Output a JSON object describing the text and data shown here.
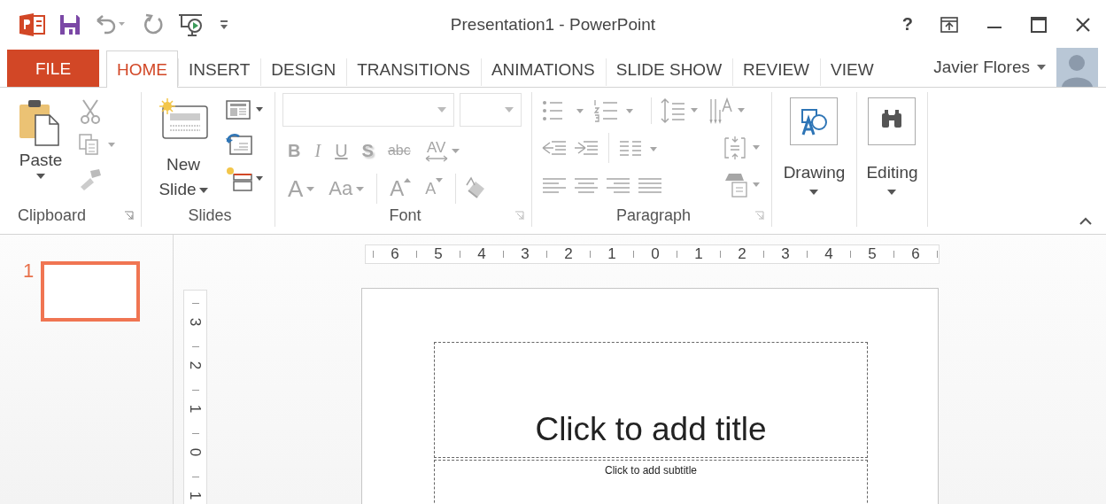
{
  "window": {
    "title": "Presentation1 - PowerPoint",
    "help": "?"
  },
  "tabs": [
    {
      "label": "FILE",
      "kind": "backstage",
      "selected": false
    },
    {
      "label": "HOME",
      "kind": "tab",
      "selected": true
    },
    {
      "label": "INSERT",
      "kind": "tab",
      "selected": false
    },
    {
      "label": "DESIGN",
      "kind": "tab",
      "selected": false
    },
    {
      "label": "TRANSITIONS",
      "kind": "tab",
      "selected": false
    },
    {
      "label": "ANIMATIONS",
      "kind": "tab",
      "selected": false
    },
    {
      "label": "SLIDE SHOW",
      "kind": "tab",
      "selected": false
    },
    {
      "label": "REVIEW",
      "kind": "tab",
      "selected": false
    },
    {
      "label": "VIEW",
      "kind": "tab",
      "selected": false
    }
  ],
  "account": {
    "name": "Javier Flores"
  },
  "ribbon": {
    "clipboard": {
      "label": "Clipboard",
      "paste": "Paste"
    },
    "slides": {
      "label": "Slides",
      "new_slide": "New Slide"
    },
    "font": {
      "label": "Font",
      "disabled": true,
      "row1": [
        {
          "label": "B",
          "kind": "bold"
        },
        {
          "label": "I",
          "kind": "italic"
        },
        {
          "label": "U",
          "kind": "underline"
        },
        {
          "label": "S",
          "kind": "shadow"
        },
        {
          "label": "abc",
          "kind": "strike"
        },
        {
          "label": "AV",
          "kind": "spacing"
        }
      ],
      "row2": [
        {
          "label": "A",
          "kind": "color"
        },
        {
          "label": "Aa",
          "kind": "case"
        },
        {
          "label": "A",
          "kind": "grow"
        },
        {
          "label": "A",
          "kind": "shrink"
        }
      ]
    },
    "paragraph": {
      "label": "Paragraph",
      "disabled": true
    },
    "drawing": {
      "label": "Drawing"
    },
    "editing": {
      "label": "Editing"
    }
  },
  "slides_pane": {
    "thumbnails": [
      {
        "number": "1",
        "selected": true
      }
    ]
  },
  "ruler": {
    "horizontal": [
      "6",
      "5",
      "4",
      "3",
      "2",
      "1",
      "0",
      "1",
      "2",
      "3",
      "4",
      "5",
      "6"
    ],
    "vertical": [
      "3",
      "2",
      "1",
      "0",
      "1"
    ]
  },
  "slide": {
    "title": {
      "placeholder": "Click to add title"
    },
    "subtitle": {
      "placeholder": "Click to add subtitle"
    }
  }
}
